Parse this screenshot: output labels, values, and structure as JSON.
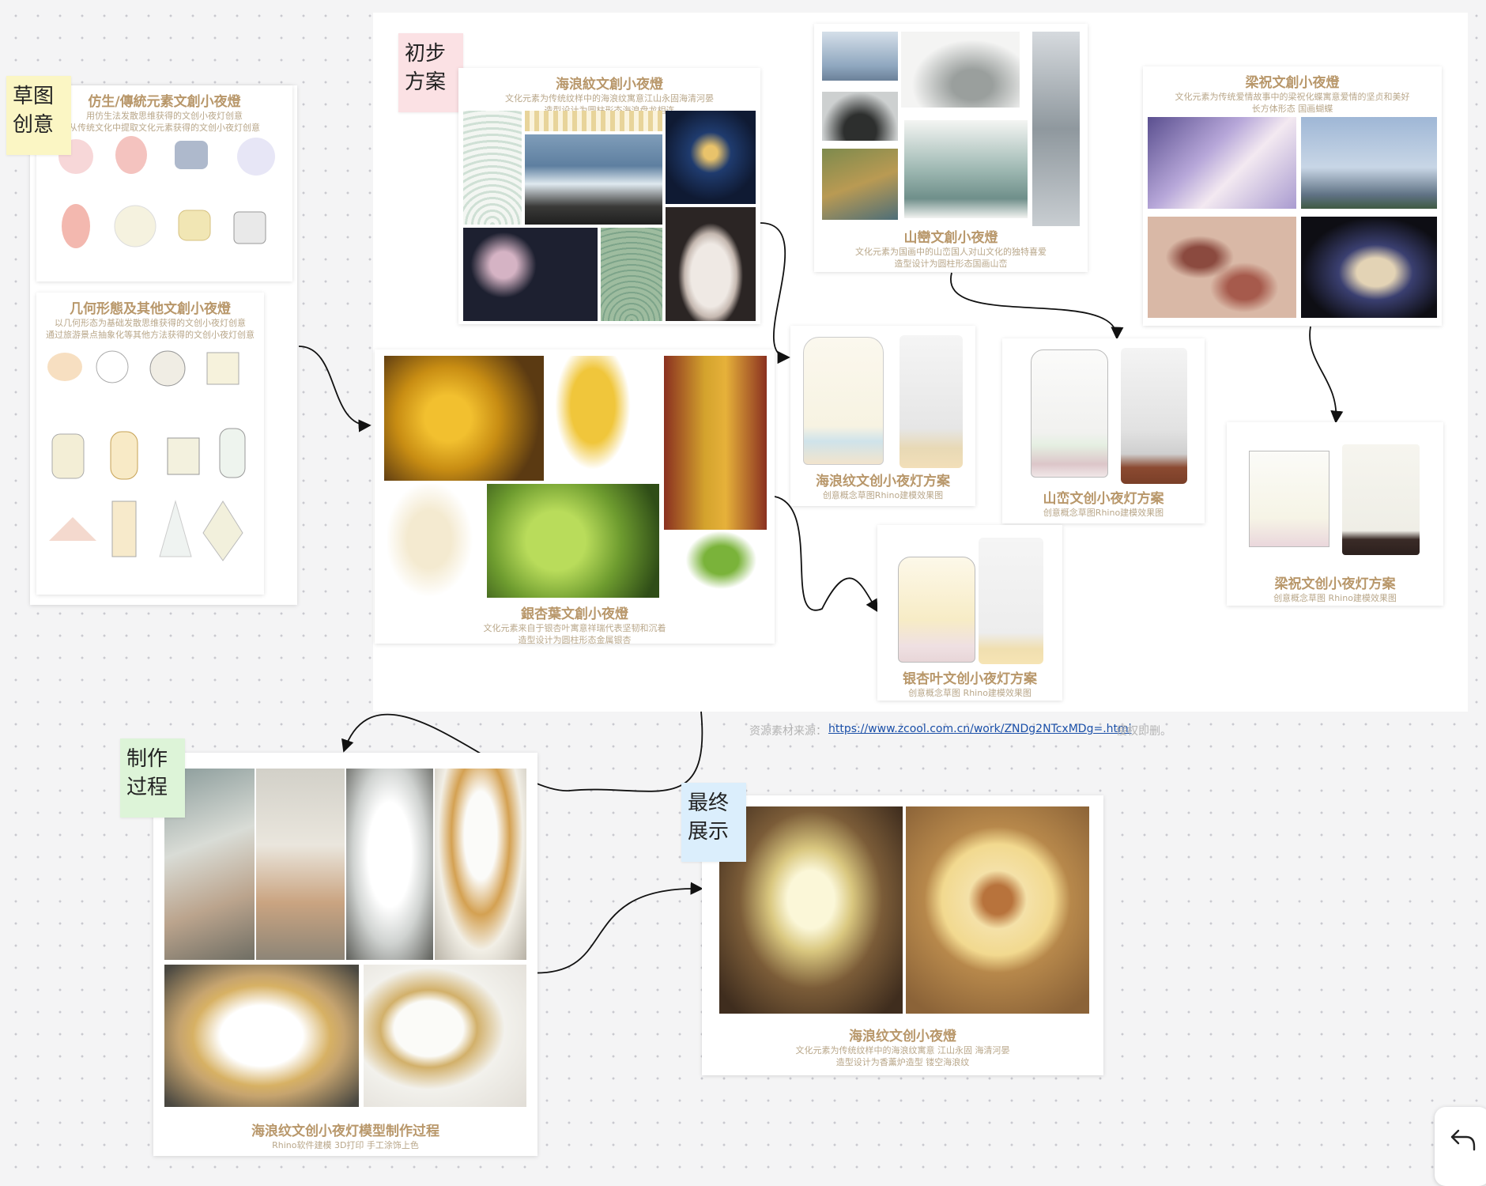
{
  "canvas": {
    "accent_link": "#1a4fa8",
    "caption_color": "#b8976a"
  },
  "stickies": {
    "sketch": "草图\n创意",
    "initial": "初步\n方案",
    "making": "制作\n过程",
    "final": "最终\n展示"
  },
  "cards": {
    "bionic": {
      "title": "仿生/傳統元素文創小夜燈",
      "desc1": "用仿生法发散思维获得的文创小夜灯创意",
      "desc2": "从传统文化中提取文化元素获得的文创小夜灯创意"
    },
    "geometric": {
      "title": "几何形態及其他文創小夜燈",
      "desc1": "以几何形态为基础发散思维获得的文创小夜灯创意",
      "desc2": "通过旅游景点抽象化等其他方法获得的文创小夜灯创意"
    },
    "wave": {
      "title": "海浪紋文創小夜燈",
      "desc1": "文化元素为传统纹样中的海浪纹寓意江山永固海清河晏",
      "desc2": "造型设计为圆柱形态海浪盘龙相连"
    },
    "mountain": {
      "title": "山巒文創小夜燈",
      "desc1": "文化元素为国画中的山峦国人对山文化的独特喜爱",
      "desc2": "造型设计为圆柱形态国画山峦"
    },
    "liangzhu": {
      "title": "梁祝文創小夜燈",
      "desc1": "文化元素为传统爱情故事中的梁祝化蝶寓意爱情的坚贞和美好",
      "desc2": "长方体形态 国画蝴蝶"
    },
    "ginkgo": {
      "title": "銀杏葉文創小夜燈",
      "desc1": "文化元素来自于银杏叶寓意祥瑞代表坚韧和沉着",
      "desc2": "造型设计为圆柱形态金属银杏"
    },
    "wave_plan": {
      "title": "海浪纹文创小夜灯方案",
      "desc": "创意概念草图Rhino建模效果图"
    },
    "mountain_plan": {
      "title": "山峦文创小夜灯方案",
      "desc": "创意概念草图Rhino建模效果图"
    },
    "ginkgo_plan": {
      "title": "银杏叶文创小夜灯方案",
      "desc": "创意概念草图 Rhino建模效果图"
    },
    "liangzhu_plan": {
      "title": "梁祝文创小夜灯方案",
      "desc": "创意概念草图 Rhino建模效果图"
    },
    "process": {
      "title": "海浪纹文创小夜灯模型制作过程",
      "desc": "Rhino软件建模 3D打印 手工涂饰上色"
    },
    "final": {
      "title": "海浪纹文创小夜燈",
      "desc1": "文化元素为传统纹样中的海浪纹寓意 江山永固 海清河晏",
      "desc2": "造型设计为香薰炉造型 镂空海浪纹"
    }
  },
  "source": {
    "label": "资源素材来源：",
    "url": "https://www.zcool.com.cn/work/ZNDg2NTcxMDg=.html",
    "suffix": "侵权即删。"
  },
  "toolbar": {
    "undo_icon": "undo-icon"
  }
}
